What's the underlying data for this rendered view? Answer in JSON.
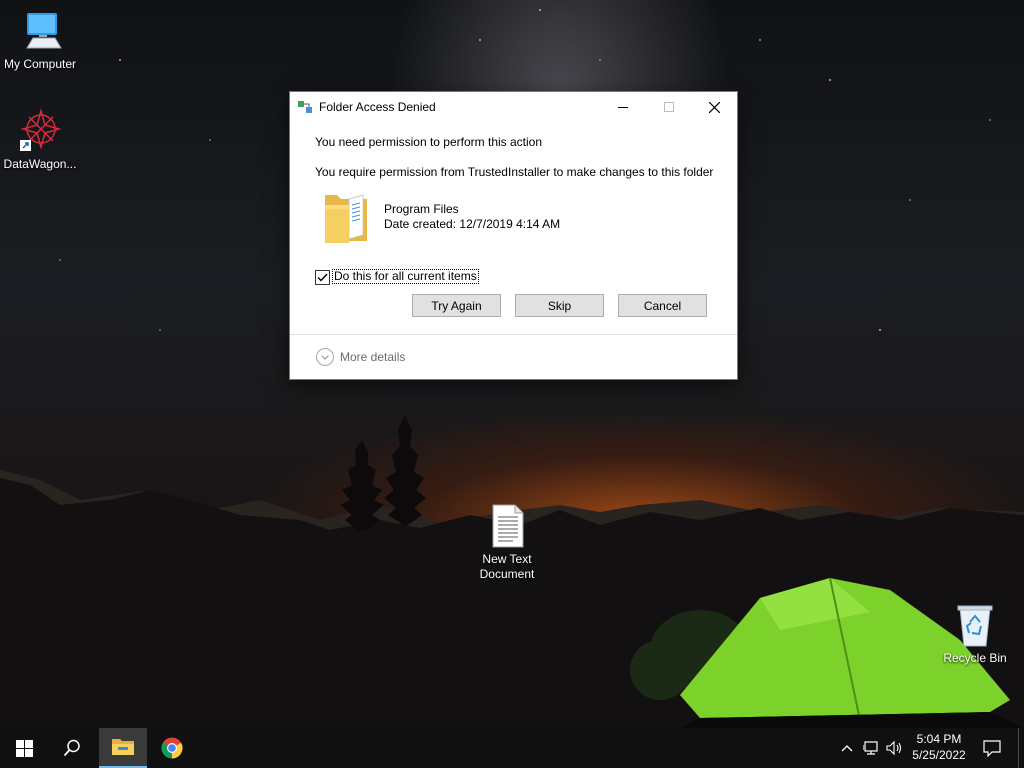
{
  "desktop": {
    "icons": {
      "my_computer": "My Computer",
      "datawagon": "DataWagon...",
      "new_text_document_line1": "New Text",
      "new_text_document_line2": "Document",
      "recycle_bin": "Recycle Bin"
    }
  },
  "dialog": {
    "title": "Folder Access Denied",
    "message_main": "You need permission to perform this action",
    "message_detail": "You require permission from TrustedInstaller to make changes to this folder",
    "folder_name": "Program Files",
    "date_label": "Date created:",
    "date_value": "12/7/2019 4:14 AM",
    "checkbox_label": "Do this for all current items",
    "checkbox_checked": true,
    "buttons": {
      "try_again": "Try Again",
      "skip": "Skip",
      "cancel": "Cancel"
    },
    "more_details": "More details"
  },
  "taskbar": {
    "clock_time": "5:04 PM",
    "clock_date": "5/25/2022",
    "pinned": [
      "start-icon",
      "search-icon",
      "file-explorer-icon",
      "chrome-icon"
    ],
    "active_app": "file-explorer"
  },
  "colors": {
    "tent_green": "#7cd12a",
    "horizon_orange": "#c85a14",
    "taskbar": "#101010",
    "button_face": "#e1e1e1"
  }
}
